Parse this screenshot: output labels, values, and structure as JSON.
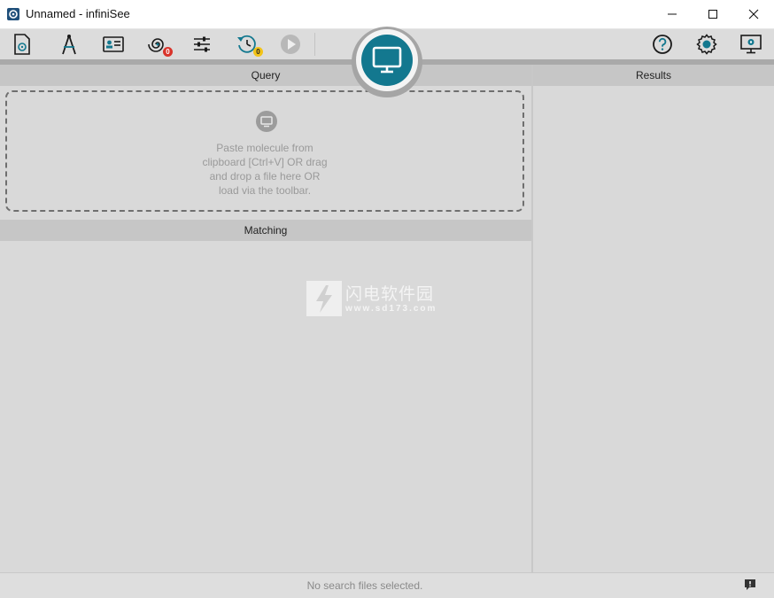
{
  "window": {
    "title": "Unnamed - infiniSee",
    "controls": [
      "minimize-icon",
      "maximize-icon",
      "close-icon"
    ]
  },
  "toolbar": {
    "left_icons": [
      "open-file-icon",
      "draw-icon",
      "molecule-card-icon",
      "spiral-icon",
      "sliders-icon",
      "history-icon",
      "play-icon"
    ],
    "spiral_badge": "0",
    "history_badge": "0",
    "right_icons": [
      "help-icon",
      "settings-icon",
      "screen-settings-icon"
    ],
    "center_icon": "monitor-icon"
  },
  "panels": {
    "query_header": "Query",
    "drop_hint_lines": [
      "Paste molecule from",
      "clipboard [Ctrl+V] OR drag",
      "and drop a file here OR",
      "load via the toolbar."
    ],
    "matching_header": "Matching",
    "results_header": "Results"
  },
  "watermark": {
    "title": "闪电软件园",
    "url": "www.sd173.com"
  },
  "status": {
    "text": "No search files selected."
  },
  "colors": {
    "accent": "#13788f",
    "badge_red": "#d9342b",
    "badge_yellow": "#f2c318"
  }
}
